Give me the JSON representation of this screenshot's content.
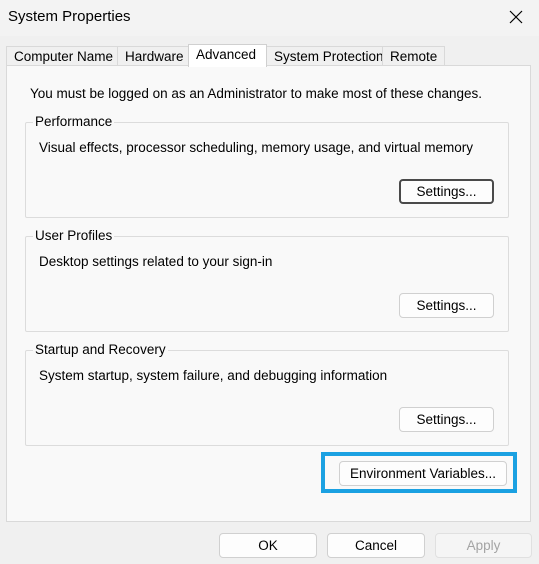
{
  "window": {
    "title": "System Properties"
  },
  "tabs": [
    {
      "label": "Computer Name"
    },
    {
      "label": "Hardware"
    },
    {
      "label": "Advanced"
    },
    {
      "label": "System Protection"
    },
    {
      "label": "Remote"
    }
  ],
  "active_tab": "Advanced",
  "notice": "You must be logged on as an Administrator to make most of these changes.",
  "groups": {
    "performance": {
      "title": "Performance",
      "description": "Visual effects, processor scheduling, memory usage, and virtual memory",
      "button": "Settings..."
    },
    "user_profiles": {
      "title": "User Profiles",
      "description": "Desktop settings related to your sign-in",
      "button": "Settings..."
    },
    "startup_recovery": {
      "title": "Startup and Recovery",
      "description": "System startup, system failure, and debugging information",
      "button": "Settings..."
    }
  },
  "environment_button": "Environment Variables...",
  "footer": {
    "ok": "OK",
    "cancel": "Cancel",
    "apply": "Apply"
  },
  "colors": {
    "highlight": "#1ba1e2"
  },
  "icons": {
    "close": "close-icon"
  }
}
